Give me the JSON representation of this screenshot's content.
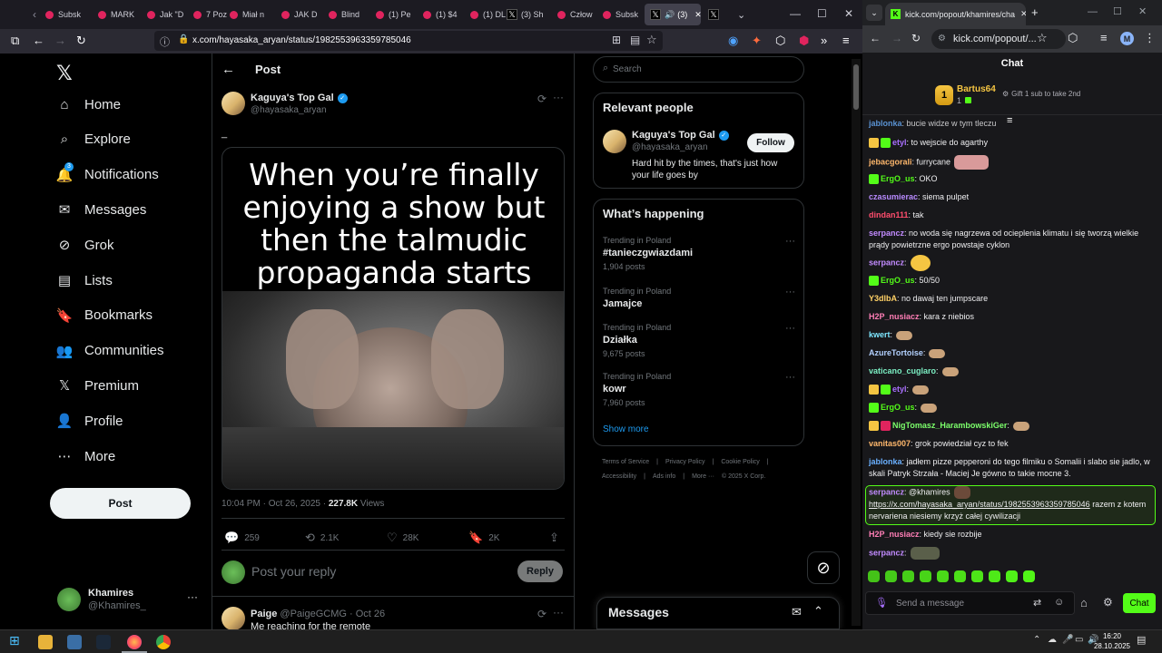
{
  "firefox": {
    "tabs": [
      {
        "label": "Subsk"
      },
      {
        "label": "MARK"
      },
      {
        "label": "Jak \"D"
      },
      {
        "label": "7 Poz"
      },
      {
        "label": "Miał n"
      },
      {
        "label": "JAK D"
      },
      {
        "label": "Blind"
      },
      {
        "label": "(1) Pe"
      },
      {
        "label": "(1) $4"
      },
      {
        "label": "(1) DL"
      },
      {
        "label": "(3) Sh"
      },
      {
        "label": "Człow"
      },
      {
        "label": "Subsk"
      }
    ],
    "active_tab": {
      "label": "(3)"
    },
    "url": "x.com/hayasaka_aryan/status/1982553963359785046"
  },
  "x": {
    "nav": [
      {
        "label": "Home",
        "icon": "home-icon"
      },
      {
        "label": "Explore",
        "icon": "search-icon"
      },
      {
        "label": "Notifications",
        "icon": "bell-icon",
        "badge": "3"
      },
      {
        "label": "Messages",
        "icon": "mail-icon"
      },
      {
        "label": "Grok",
        "icon": "grok-icon"
      },
      {
        "label": "Lists",
        "icon": "list-icon"
      },
      {
        "label": "Bookmarks",
        "icon": "bookmark-icon"
      },
      {
        "label": "Communities",
        "icon": "people-icon"
      },
      {
        "label": "Premium",
        "icon": "x-icon"
      },
      {
        "label": "Profile",
        "icon": "user-icon"
      },
      {
        "label": "More",
        "icon": "more-icon"
      }
    ],
    "post_button": "Post",
    "account": {
      "name": "Khamires",
      "handle": "@Khamires_"
    },
    "header_title": "Post",
    "post": {
      "author": "Kaguya's Top Gal",
      "handle": "@hayasaka_aryan",
      "text": "_",
      "meme_lines": [
        "When you’re finally",
        "enjoying a show but",
        "then the talmudic",
        "propaganda starts"
      ],
      "timestamp": "10:04 PM · Oct 26, 2025 · ",
      "views_count": "227.8K",
      "views_label": " Views",
      "replies": "259",
      "reposts": "2.1K",
      "likes": "28K",
      "bookmarks": "2K"
    },
    "reply_placeholder": "Post your reply",
    "reply_button": "Reply",
    "next_reply": {
      "author": "Paige",
      "handle": "@PaigeGCMG",
      "date": "· Oct 26",
      "text": "Me reaching for the remote"
    },
    "search_placeholder": "Search",
    "relevant": {
      "title": "Relevant people",
      "name": "Kaguya's Top Gal",
      "handle": "@hayasaka_aryan",
      "follow": "Follow",
      "bio": "Hard hit by the times, that's just how your life goes by"
    },
    "happening": {
      "title": "What’s happening",
      "trends": [
        {
          "context": "Trending in Poland",
          "topic": "#tanieczgwiazdami",
          "count": "1,904 posts"
        },
        {
          "context": "Trending in Poland",
          "topic": "Jamajce",
          "count": ""
        },
        {
          "context": "Trending in Poland",
          "topic": "Działka",
          "count": "9,675 posts"
        },
        {
          "context": "Trending in Poland",
          "topic": "kowr",
          "count": "7,960 posts"
        }
      ],
      "show_more": "Show more"
    },
    "footer": {
      "row1": [
        "Terms of Service",
        "|",
        "Privacy Policy",
        "|",
        "Cookie Policy",
        "|"
      ],
      "row2": [
        "Accessibility",
        "|",
        "Ads info",
        "|",
        "More ···",
        "© 2025 X Corp."
      ]
    },
    "messages_drawer": "Messages"
  },
  "chrome": {
    "tab_title": "kick.com/popout/khamires/cha",
    "url": "kick.com/popout/...",
    "profile_initial": "M"
  },
  "kick": {
    "title": "Chat",
    "top_gifter": {
      "name": "Bartus64",
      "rank": "1",
      "count": "1"
    },
    "gift_text": "Gift 1 sub to take 2nd",
    "partial_top": {
      "user": "jablonka",
      "text": ": bucie widze w tym tleczu"
    },
    "messages": [
      {
        "user": "etyl",
        "color": "#a970ff",
        "text": ": to wejscie do agarthy"
      },
      {
        "user": "jebacgorali",
        "color": "#ffb86c",
        "text": ": furrycane"
      },
      {
        "user": "ErgO_us",
        "color": "#53fc18",
        "text": ": OKO"
      },
      {
        "user": "czasumierac",
        "color": "#b98bff",
        "text": ": siema pulpet"
      },
      {
        "user": "dindan111",
        "color": "#ff4d6d",
        "text": ": tak"
      },
      {
        "user": "serpancz",
        "color": "#c28bff",
        "text": ": no woda się nagrzewa od ocieplenia klimatu i się tworzą wielkie prądy powietrzne ergo powstaje cyklon"
      },
      {
        "user": "serpancz",
        "color": "#c28bff",
        "text": ":"
      },
      {
        "user": "ErgO_us",
        "color": "#53fc18",
        "text": ": 50/50"
      },
      {
        "user": "Y3dlbA",
        "color": "#ffd166",
        "text": ": no dawaj ten jumpscare"
      },
      {
        "user": "H2P_nusiacz",
        "color": "#ff7eb6",
        "text": ": kara z niebios"
      },
      {
        "user": "kwert",
        "color": "#7ee7ff",
        "text": ":"
      },
      {
        "user": "AzureTortoise",
        "color": "#b3d1ff",
        "text": ":"
      },
      {
        "user": "vaticano_cuglaro",
        "color": "#7cf0c4",
        "text": ":"
      },
      {
        "user": "etyl",
        "color": "#a970ff",
        "text": ":"
      },
      {
        "user": "ErgO_us",
        "color": "#53fc18",
        "text": ":"
      },
      {
        "user": "NigTomasz_HarambowskiGer",
        "color": "#7cff6b",
        "text": ":"
      },
      {
        "user": "vanitas007",
        "color": "#ffb86c",
        "text": ": grok powiedział cyz to fek"
      },
      {
        "user": "jablonka",
        "color": "#6ab0ff",
        "text": ": jadłem pizze pepperoni do tego filmiku o Somalii i slabo sie jadlo, w skali Patryk Strzała - Maciej Je gówno to takie mocne 3."
      },
      {
        "user": "serpancz",
        "color": "#c28bff",
        "text": ": @khamires"
      },
      {
        "user": "H2P_nusiacz",
        "color": "#ff7eb6",
        "text": ": kiedy sie rozbije"
      },
      {
        "user": "serpancz",
        "color": "#c28bff",
        "text": ":"
      }
    ],
    "highlight_link": "https://x.com/hayasaka_aryan/status/1982553963359785046",
    "highlight_after": " razem z kotem nervariena niesiemy krzyż całej cywilizacji",
    "input_placeholder": "Send a message",
    "chat_button": "Chat"
  },
  "taskbar": {
    "time": "16:20",
    "date": "28.10.2025"
  },
  "colors": {
    "kick_green": "#53fc18",
    "x_blue": "#1d9bf0",
    "verified": "#1d9bf0"
  }
}
